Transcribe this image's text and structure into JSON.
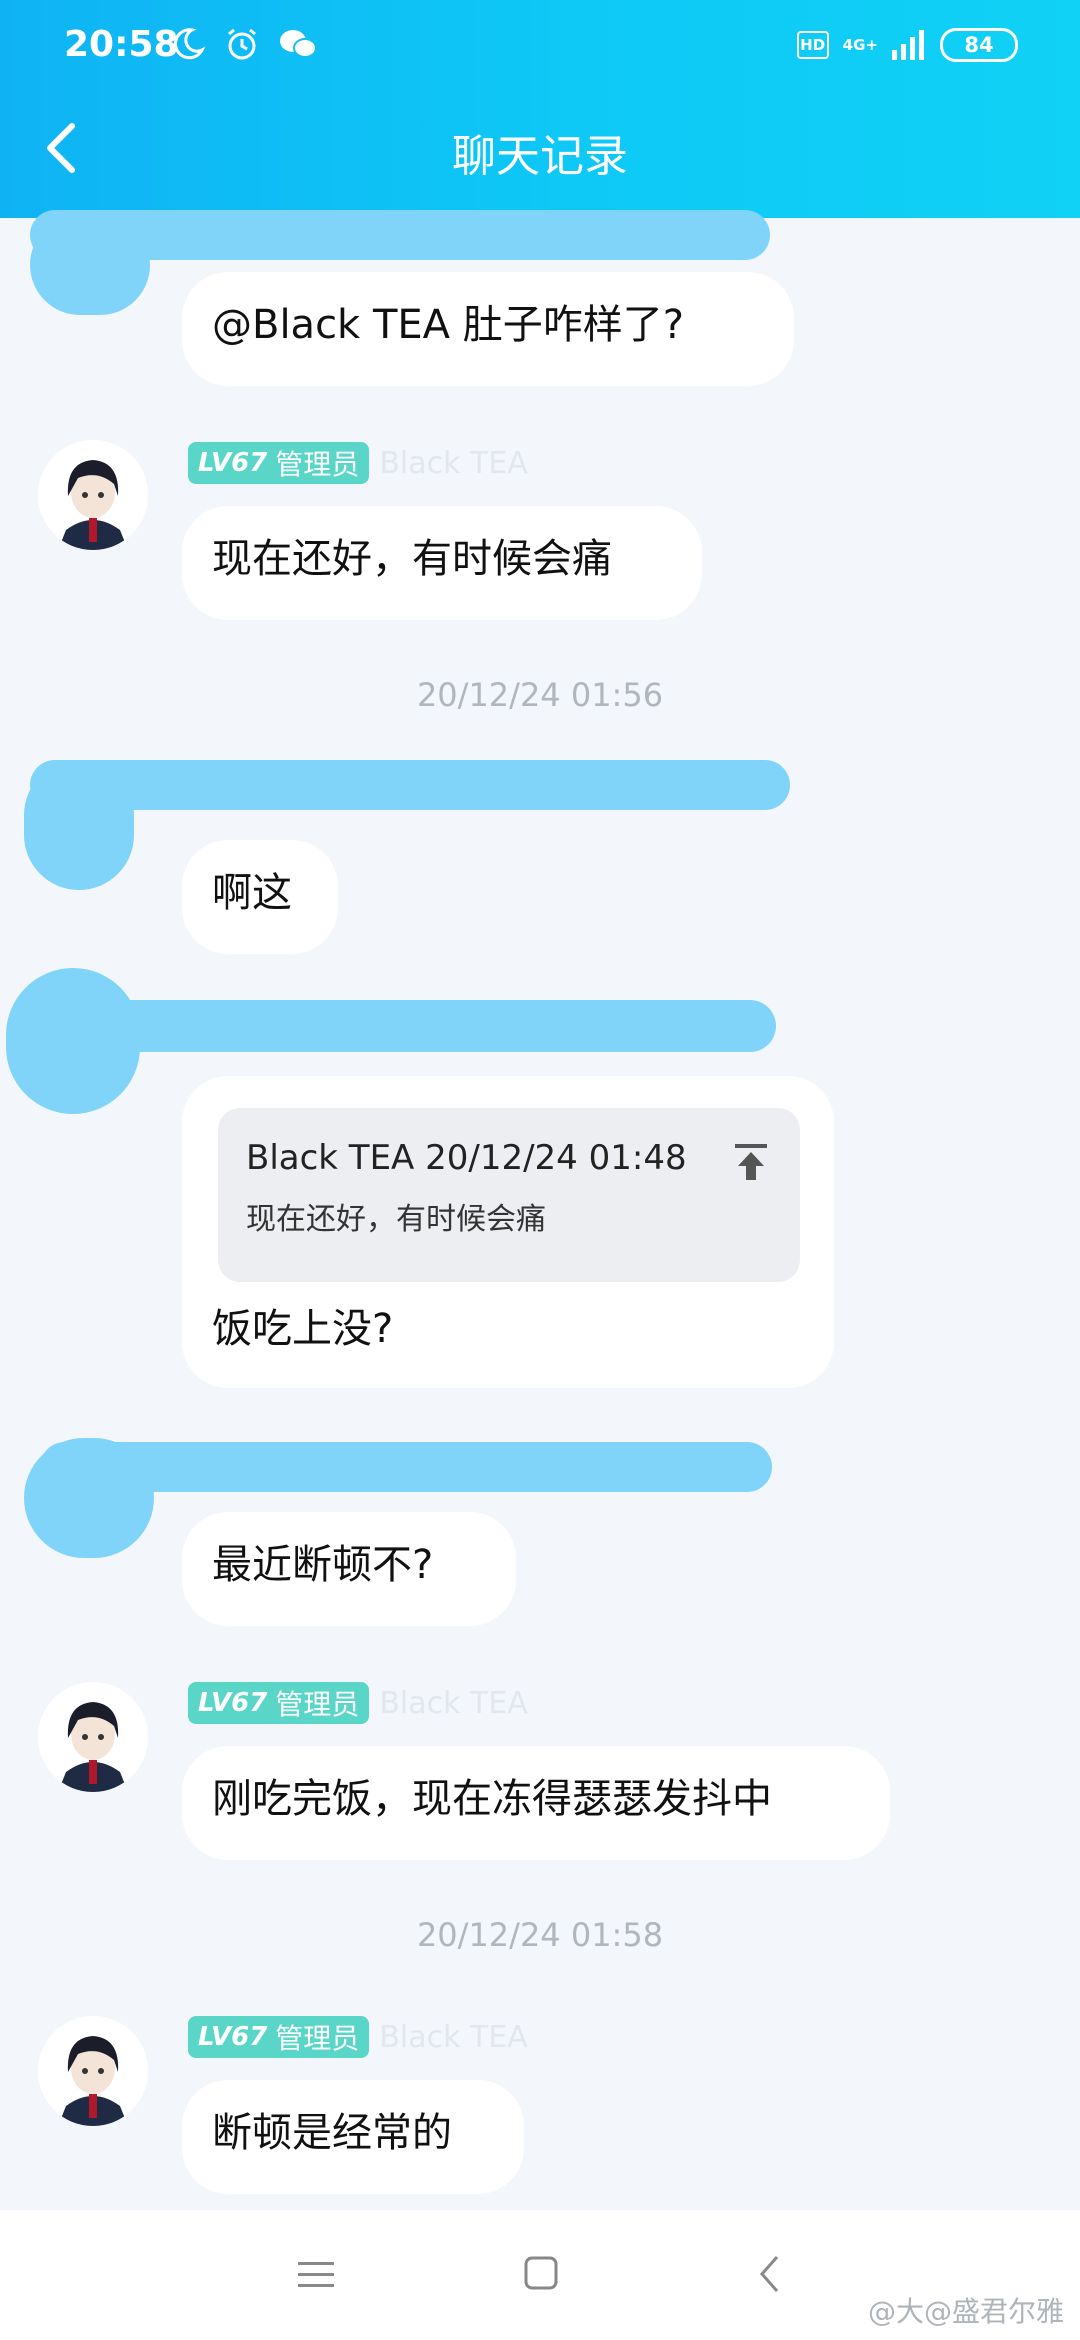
{
  "status_bar": {
    "time": "20:58",
    "icons_left": [
      "moon-icon",
      "alarm-icon",
      "wechat-icon"
    ],
    "hd": "HD",
    "network": "4G+",
    "battery": "84"
  },
  "header": {
    "title": "聊天记录",
    "back_icon": "chevron-left-icon"
  },
  "messages": [
    {
      "text": "@Black TEA 肚子咋样了?"
    },
    {
      "badge_level": "LV67",
      "badge_role": "管理员",
      "nickname": "Black TEA",
      "text": "现在还好，有时候会痛"
    },
    {
      "time": "20/12/24 01:56"
    },
    {
      "text": "啊这"
    },
    {
      "quote": {
        "author_time": "Black TEA 20/12/24 01:48",
        "text": "现在还好，有时候会痛"
      },
      "text": "饭吃上没?"
    },
    {
      "text": "最近断顿不?"
    },
    {
      "badge_level": "LV67",
      "badge_role": "管理员",
      "nickname": "Black TEA",
      "text": "刚吃完饭，现在冻得瑟瑟发抖中"
    },
    {
      "time": "20/12/24 01:58"
    },
    {
      "badge_level": "LV67",
      "badge_role": "管理员",
      "nickname": "Black TEA",
      "text": "断顿是经常的"
    }
  ],
  "nav": {
    "menu_icon": "menu-icon",
    "home_icon": "home-square-icon",
    "back_icon": "back-triangle-icon"
  },
  "watermark": "@大@盛君尔雅",
  "colors": {
    "header": "#0fb3f4",
    "badge": "#5ad6c8",
    "scribble": "#80d4f9",
    "background": "#f3f6fa"
  }
}
